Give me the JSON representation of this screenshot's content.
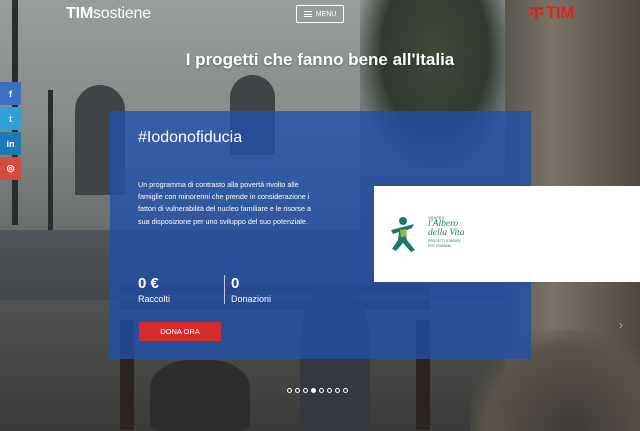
{
  "header": {
    "logo_bold": "TIM",
    "logo_rest": "sostiene",
    "menu_label": "MENU",
    "brand": "TIM",
    "brand_color": "#e2231a"
  },
  "headline": "I progetti che fanno bene all'Italia",
  "social": [
    {
      "icon": "facebook-icon",
      "glyph": "f",
      "color": "#3f6fc1"
    },
    {
      "icon": "twitter-icon",
      "glyph": "t",
      "color": "#2fa0d8"
    },
    {
      "icon": "linkedin-icon",
      "glyph": "in",
      "color": "#1d7bb3"
    },
    {
      "icon": "instagram-icon",
      "glyph": "◎",
      "color": "#d54c3f"
    }
  ],
  "project": {
    "title": "#Iodonofiducia",
    "description": "Un programma di contrasto alla povertà rivolto alle famiglie con minorenni che prende in considerazione i fattori di vulnerabilità del nucleo familiare e le risorse a sua disposizione per uno sviluppo del suo potenziale.",
    "raised_value": "0 €",
    "raised_label": "Raccolti",
    "donations_value": "0",
    "donations_label": "Donazioni",
    "donate_label": "DONA ORA",
    "card_color": "#204faa",
    "button_color": "#d52b2b"
  },
  "partner": {
    "small": "GRUPPO",
    "name_line1": "l'Albero",
    "name_line2": "della Vita",
    "tagline_line1": "PROGETTI D'AMORE",
    "tagline_line2": "PER I BAMBINI",
    "color": "#1b7b68"
  },
  "carousel": {
    "total": 8,
    "active_index": 3,
    "next_glyph": "›"
  }
}
